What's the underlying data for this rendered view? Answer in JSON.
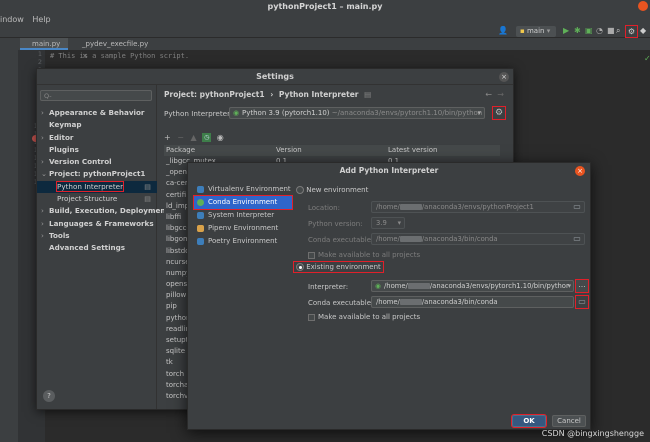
{
  "window": {
    "title": "pythonProject1 – main.py"
  },
  "menu": [
    "indow",
    "Help"
  ],
  "toolbar": {
    "run_config": "main"
  },
  "tabs": [
    "main.py",
    "_pydev_execfile.py"
  ],
  "editor": {
    "line_numbers": [
      "1",
      "2",
      "3",
      "4",
      "5",
      "6",
      "7",
      "8",
      "9",
      "10",
      "11",
      "12",
      "13",
      "14",
      "15",
      "16",
      "17"
    ],
    "first_line": "# This is a sample Python script."
  },
  "settings": {
    "title": "Settings",
    "search_placeholder": "Q-",
    "tree": [
      {
        "label": "Appearance & Behavior",
        "arrow": "›"
      },
      {
        "label": "Keymap",
        "arrow": ""
      },
      {
        "label": "Editor",
        "arrow": "›"
      },
      {
        "label": "Plugins",
        "arrow": ""
      },
      {
        "label": "Version Control",
        "arrow": "›"
      },
      {
        "label": "Project: pythonProject1",
        "arrow": "⌄"
      },
      {
        "label": "Python Interpreter",
        "arrow": "",
        "sub": true,
        "selected": true
      },
      {
        "label": "Project Structure",
        "arrow": "",
        "sub": true
      },
      {
        "label": "Build, Execution, Deployment",
        "arrow": "›"
      },
      {
        "label": "Languages & Frameworks",
        "arrow": "›"
      },
      {
        "label": "Tools",
        "arrow": "›"
      },
      {
        "label": "Advanced Settings",
        "arrow": ""
      }
    ],
    "breadcrumb": {
      "project": "Project: pythonProject1",
      "sep": "›",
      "page": "Python Interpreter"
    },
    "interpreter_label": "Python Interpreter:",
    "interpreter_value": "Python 3.9 (pytorch1.10)",
    "interpreter_path": "~/anaconda3/envs/pytorch1.10/bin/python",
    "table_headers": [
      "Package",
      "Version",
      "Latest version"
    ],
    "packages": [
      "_libgcc_mutex",
      "_openmp",
      "ca-certi",
      "certifi",
      "ld_impl",
      "libffi",
      "libgcc-n",
      "libgom",
      "libstdc",
      "ncurses",
      "numpy",
      "openssl",
      "pillow",
      "pip",
      "python",
      "readlin",
      "setupt",
      "sqlite",
      "tk",
      "torch",
      "torcha",
      "torchvi"
    ],
    "first_versions": [
      "0.1",
      "0.1"
    ]
  },
  "add_dialog": {
    "title": "Add Python Interpreter",
    "envs": [
      "Virtualenv Environment",
      "Conda Environment",
      "System Interpreter",
      "Pipenv Environment",
      "Poetry Environment"
    ],
    "new_env_label": "New environment",
    "location_label": "Location:",
    "location_pre": "/home/",
    "location_post": "/anaconda3/envs/pythonProject1",
    "python_version_label": "Python version:",
    "python_version_value": "3.9",
    "conda_exec_label": "Conda executable:",
    "conda_exec_pre": "/home/",
    "conda_exec_post": "/anaconda3/bin/conda",
    "make_available_label": "Make available to all projects",
    "existing_env_label": "Existing environment",
    "interpreter_label": "Interpreter:",
    "interpreter_pre": "/home/",
    "interpreter_post": "/anaconda3/envs/pytorch1.10/bin/pythor",
    "conda_exec2_label": "Conda executable:",
    "conda_exec2_pre": "/home/",
    "conda_exec2_post": "/anaconda3/bin/conda",
    "make_available2_label": "Make available to all projects",
    "ok_label": "OK",
    "cancel_label": "Cancel"
  },
  "watermark": "CSDN @bingxingshengge"
}
